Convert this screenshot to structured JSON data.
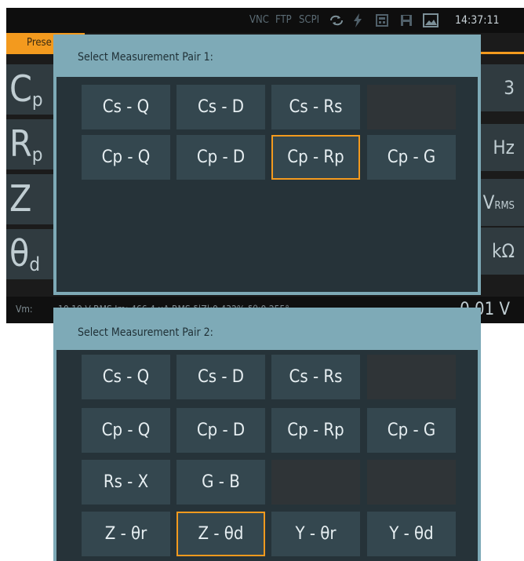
{
  "status_bar": {
    "indicators": [
      "VNC",
      "FTP",
      "SCPI"
    ],
    "icons": [
      "sync-icon",
      "lightning-icon",
      "calculator-icon",
      "save-icon",
      "screenshot-icon"
    ],
    "clock": "14:37:11"
  },
  "preset_tab": {
    "label": "Prese"
  },
  "background_params": {
    "labels": [
      {
        "main": "C",
        "sub": "p"
      },
      {
        "main": "R",
        "sub": "p"
      },
      {
        "main": "Z",
        "sub": ""
      },
      {
        "main": "θ",
        "sub": "d"
      }
    ],
    "units": [
      {
        "main": "3",
        "sub": ""
      },
      {
        "main": "Hz",
        "sub": ""
      },
      {
        "main": "V",
        "sub": "RMS"
      },
      {
        "main": "kΩ",
        "sub": ""
      }
    ]
  },
  "readout_bar": {
    "vm_label": "Vm:",
    "text": "10.19 V RMS  Im: 466.4 µA RMS  δ|Z|:0.432%  δθ:0.255°",
    "value": "0.01 V"
  },
  "dialog1": {
    "title": "Select Measurement Pair 1:",
    "buttons": [
      "Cs - Q",
      "Cs - D",
      "Cs - Rs",
      "Cp - Q",
      "Cp - D",
      "Cp - Rp",
      "Cp - G"
    ],
    "selected": "Cp - Rp"
  },
  "dialog2": {
    "title": "Select Measurement Pair 2:",
    "buttons": [
      "Cs - Q",
      "Cs - D",
      "Cs - Rs",
      "Cp - Q",
      "Cp - D",
      "Cp - Rp",
      "Cp - G",
      "Rs - X",
      "G - B",
      "Z - θr",
      "Z - θd",
      "Y - θr",
      "Y - θd"
    ],
    "selected": "Z - θd"
  },
  "colors": {
    "accent": "#f39a1e",
    "dialog_header": "#7eaab7",
    "button_bg": "#34474f",
    "dialog_body": "#263339"
  }
}
